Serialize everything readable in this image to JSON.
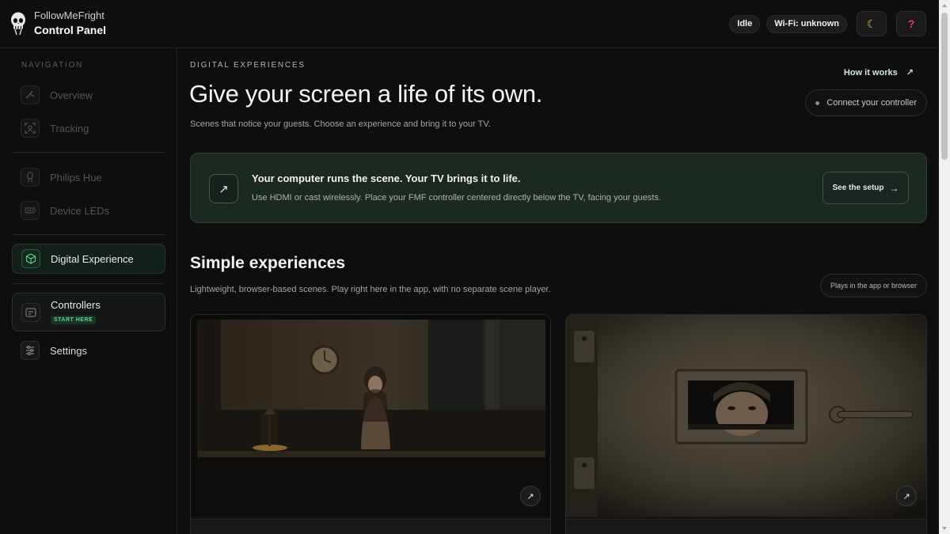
{
  "brand": {
    "app_name": "FollowMeFright",
    "title": "Control Panel"
  },
  "header": {
    "status": "Idle",
    "wifi": "Wi-Fi: unknown",
    "theme_icon": "moon-icon",
    "help_label": "?"
  },
  "sidebar": {
    "title": "NAVIGATION",
    "items": [
      {
        "label": "Overview",
        "icon": "overview-icon"
      },
      {
        "label": "Tracking",
        "icon": "tracking-icon"
      },
      {
        "label": "Philips Hue",
        "icon": "hue-bulb-icon"
      },
      {
        "label": "Device LEDs",
        "icon": "led-strip-icon"
      },
      {
        "label": "Digital Experience",
        "icon": "cube-icon"
      },
      {
        "label": "Controllers",
        "icon": "controller-icon",
        "badge": "START HERE"
      },
      {
        "label": "Settings",
        "icon": "sliders-icon"
      }
    ]
  },
  "main": {
    "kicker": "DIGITAL EXPERIENCES",
    "title": "Give your screen a life of its own.",
    "subtitle": "Scenes that notice your guests. Choose an experience and bring it to your TV.",
    "how_it_works": "How it works",
    "connect_label": "Connect your controller",
    "banner": {
      "title": "Your computer runs the scene. Your TV brings it to life.",
      "body": "Use HDMI or cast wirelessly. Place your FMF controller centered directly below the TV, facing your guests.",
      "button": "See the setup"
    },
    "section": {
      "title": "Simple experiences",
      "subtitle": "Lightweight, browser-based scenes. Play right here in the app, with no separate scene player.",
      "pill": "Plays in the app or browser"
    }
  },
  "colors": {
    "accent": "#5fd18e",
    "banner_bg": "#1c2921",
    "help": "#e53b5d",
    "moon": "#f1c14e"
  }
}
